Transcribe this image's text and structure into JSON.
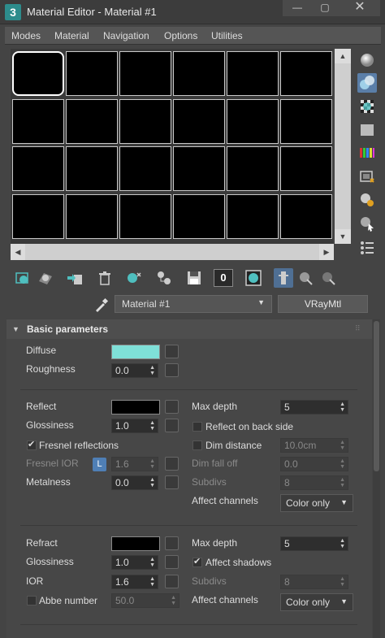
{
  "window": {
    "app_icon_text": "3",
    "title": "Material Editor - Material #1",
    "minimize": "—",
    "maximize": "▢",
    "close": "✕"
  },
  "menu": [
    "Modes",
    "Material",
    "Navigation",
    "Options",
    "Utilities"
  ],
  "toolbar": {
    "zero_button": "0"
  },
  "material": {
    "name": "Material #1",
    "type": "VRayMtl"
  },
  "rollout": {
    "title": "Basic parameters"
  },
  "diffuse": {
    "label": "Diffuse",
    "color": "#7fe0d8",
    "roughness_label": "Roughness",
    "roughness_value": "0.0"
  },
  "reflect": {
    "label": "Reflect",
    "color": "#000000",
    "glossiness_label": "Glossiness",
    "glossiness_value": "1.0",
    "fresnel_label": "Fresnel reflections",
    "fresnel_ior_label": "Fresnel IOR",
    "lock_badge": "L",
    "fresnel_ior_value": "1.6",
    "metalness_label": "Metalness",
    "metalness_value": "0.0",
    "max_depth_label": "Max depth",
    "max_depth_value": "5",
    "back_side_label": "Reflect on back side",
    "dim_distance_label": "Dim distance",
    "dim_distance_value": "10.0cm",
    "dim_falloff_label": "Dim fall off",
    "dim_falloff_value": "0.0",
    "subdivs_label": "Subdivs",
    "subdivs_value": "8",
    "affect_channels_label": "Affect channels",
    "affect_channels_value": "Color only"
  },
  "refract": {
    "label": "Refract",
    "color": "#000000",
    "glossiness_label": "Glossiness",
    "glossiness_value": "1.0",
    "ior_label": "IOR",
    "ior_value": "1.6",
    "abbe_label": "Abbe number",
    "abbe_value": "50.0",
    "max_depth_label": "Max depth",
    "max_depth_value": "5",
    "affect_shadows_label": "Affect shadows",
    "subdivs_label": "Subdivs",
    "subdivs_value": "8",
    "affect_channels_label": "Affect channels",
    "affect_channels_value": "Color only"
  }
}
